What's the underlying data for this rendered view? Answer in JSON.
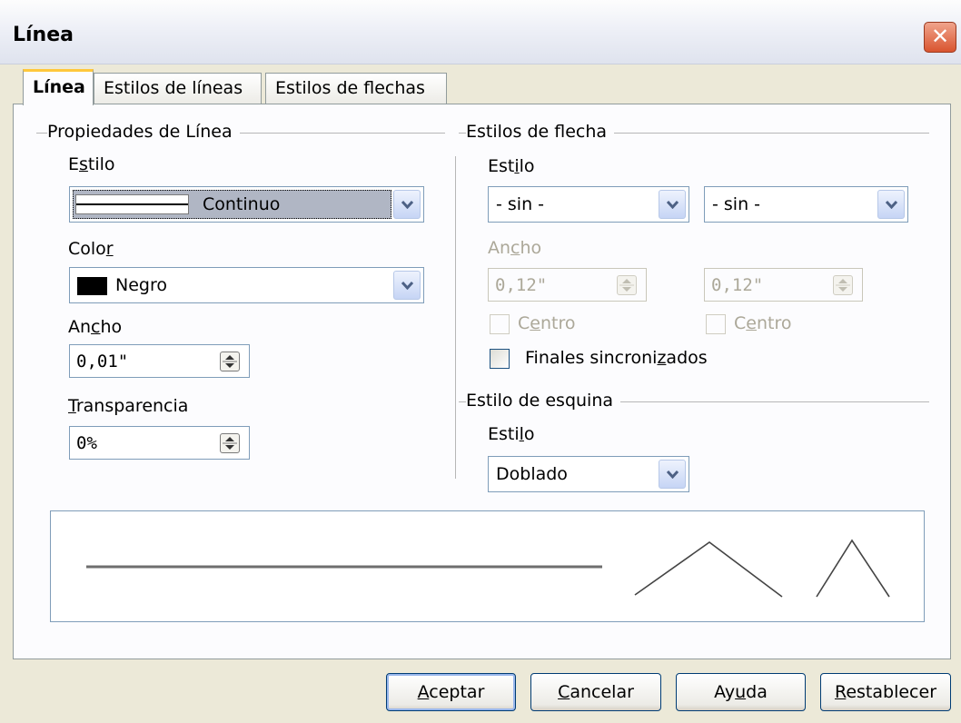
{
  "window": {
    "title": "Línea",
    "close_symbol": "✕"
  },
  "tabs": [
    {
      "label": "Línea",
      "active": true
    },
    {
      "label": "Estilos de líneas",
      "active": false
    },
    {
      "label": "Estilos de flechas",
      "active": false
    }
  ],
  "line_properties": {
    "group_title": "Propiedades de Línea",
    "style": {
      "label_pre": "E",
      "label_key": "s",
      "label_post": "tilo",
      "value": "Continuo"
    },
    "color": {
      "label_pre": "Colo",
      "label_key": "r",
      "label_post": "",
      "value": "Negro",
      "swatch": "#000000"
    },
    "width": {
      "label_pre": "An",
      "label_key": "c",
      "label_post": "ho",
      "value": "0,01\""
    },
    "transparency": {
      "label_pre": "",
      "label_key": "T",
      "label_post": "ransparencia",
      "value": "0%"
    }
  },
  "arrow_styles": {
    "group_title": "Estilos de flecha",
    "style": {
      "label_pre": "Est",
      "label_key": "i",
      "label_post": "lo",
      "start_value": "- sin -",
      "end_value": "- sin -"
    },
    "width": {
      "label_pre": "An",
      "label_key": "c",
      "label_post": "ho",
      "start_value": "0,12\"",
      "end_value": "0,12\""
    },
    "center_start": {
      "label_pre": "C",
      "label_key": "e",
      "label_post": "ntro",
      "checked": false
    },
    "center_end": {
      "label_pre": "C",
      "label_key": "e",
      "label_post": "ntro",
      "checked": false
    },
    "sync_ends": {
      "label_pre": "Finales sincroni",
      "label_key": "z",
      "label_post": "ados",
      "checked": false
    }
  },
  "corner_style": {
    "group_title": "Estilo de esquina",
    "style": {
      "label_pre": "Esti",
      "label_key": "l",
      "label_post": "o",
      "value": "Doblado"
    }
  },
  "buttons": {
    "ok": {
      "pre": "",
      "key": "A",
      "post": "ceptar"
    },
    "cancel": {
      "pre": "",
      "key": "C",
      "post": "ancelar"
    },
    "help": {
      "pre": "Ay",
      "key": "u",
      "post": "da"
    },
    "reset": {
      "pre": "",
      "key": "R",
      "post": "establecer"
    }
  },
  "colors": {
    "accent_tab": "#ffc83c",
    "close_button": "#d9542f",
    "border": "#7f9db9"
  }
}
